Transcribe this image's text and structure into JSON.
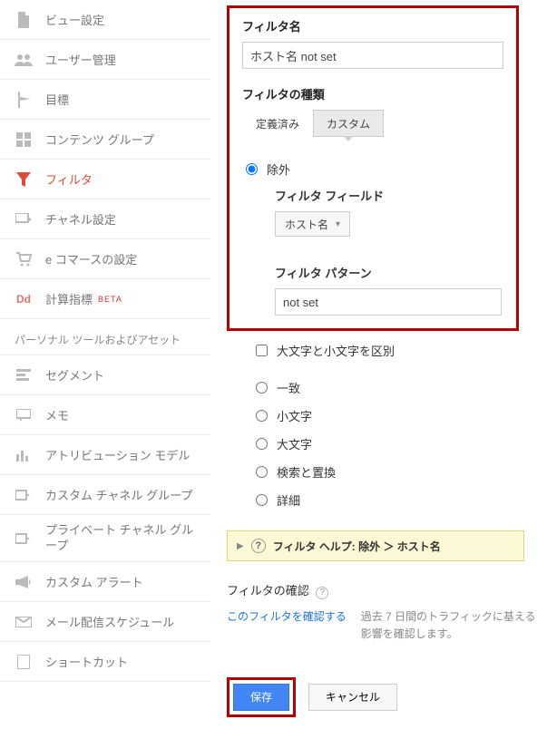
{
  "sidebar": {
    "items": [
      {
        "label": "ビュー設定"
      },
      {
        "label": "ユーザー管理"
      },
      {
        "label": "目標"
      },
      {
        "label": "コンテンツ グループ"
      },
      {
        "label": "フィルタ"
      },
      {
        "label": "チャネル設定"
      },
      {
        "label": "e コマースの設定"
      },
      {
        "label": "計算指標",
        "badge": "BETA"
      }
    ],
    "section_heading": "パーソナル ツールおよびアセット",
    "tools": [
      {
        "label": "セグメント"
      },
      {
        "label": "メモ"
      },
      {
        "label": "アトリビューション モデル"
      },
      {
        "label": "カスタム チャネル グループ"
      },
      {
        "label": "プライベート チャネル グループ"
      },
      {
        "label": "カスタム アラート"
      },
      {
        "label": "メール配信スケジュール"
      },
      {
        "label": "ショートカット"
      }
    ]
  },
  "form": {
    "filter_name_label": "フィルタ名",
    "filter_name_value": "ホスト名 not set",
    "filter_type_label": "フィルタの種類",
    "tab_predefined": "定義済み",
    "tab_custom": "カスタム",
    "exclude_label": "除外",
    "filter_field_label": "フィルタ フィールド",
    "filter_field_value": "ホスト名",
    "filter_pattern_label": "フィルタ パターン",
    "filter_pattern_value": "not set",
    "case_label": "大文字と小文字を区別",
    "radios": {
      "match": "一致",
      "lower": "小文字",
      "upper": "大文字",
      "search_replace": "検索と置換",
      "detail": "詳細"
    },
    "help_text": "フィルタ ヘルプ: 除外 ＞ ホスト名",
    "confirm_label": "フィルタの確認",
    "confirm_link": "このフィルタを確認する",
    "confirm_desc": "過去 7 日間のトラフィックに基える影響を確認します。",
    "save": "保存",
    "cancel": "キャンセル"
  }
}
